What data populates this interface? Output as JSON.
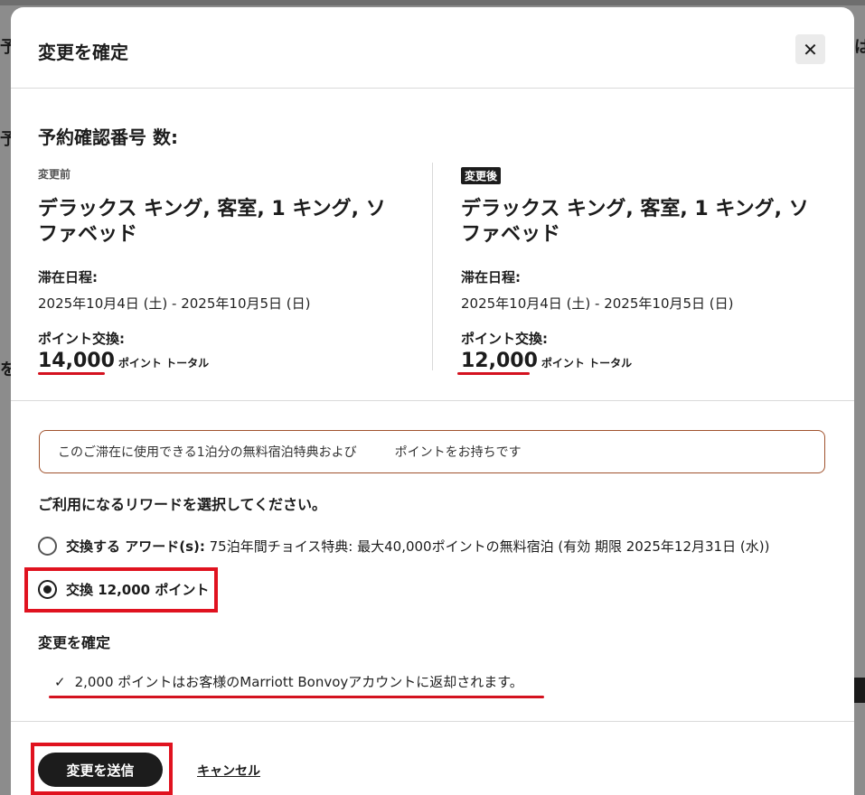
{
  "modal": {
    "title": "変更を確定",
    "close_icon": "close-icon",
    "section_title": "予約確認番号 数:"
  },
  "before": {
    "tag": "変更前",
    "room": "デラックス キング, 客室, 1 キング, ソファベッド",
    "stay_label": "滞在日程:",
    "dates": "2025年10月4日 (土) - 2025年10月5日 (日)",
    "points_label": "ポイント交換:",
    "points": "14,000",
    "points_unit": "ポイント トータル"
  },
  "after": {
    "tag": "変更後",
    "room": "デラックス キング, 客室, 1 キング, ソファベッド",
    "stay_label": "滞在日程:",
    "dates": "2025年10月4日 (土) - 2025年10月5日 (日)",
    "points_label": "ポイント交換:",
    "points": "12,000",
    "points_unit": "ポイント トータル"
  },
  "info_box": {
    "text_a": "このご滞在に使用できる1泊分の無料宿泊特典および",
    "text_b": "ポイントをお持ちです"
  },
  "choose_label": "ご利用になるリワードを選択してください。",
  "options": [
    {
      "bold": "交換する アワード(s):",
      "text": " 75泊年間チョイス特典: 最大40,000ポイントの無料宿泊 (有効 期限 2025年12月31日 (水))",
      "selected": false
    },
    {
      "bold": "交換 12,000 ポイント",
      "text": "",
      "selected": true
    }
  ],
  "confirm": {
    "label": "変更を確定",
    "check_icon": "check-icon",
    "refund_text": "2,000  ポイントはお客様のMarriott Bonvoyアカウントに返却されます。"
  },
  "buttons": {
    "submit": "変更を送信",
    "cancel": "キャンセル"
  },
  "colors": {
    "highlight": "#e0121f",
    "info_border": "#a0522d",
    "primary": "#1c1c1c"
  }
}
